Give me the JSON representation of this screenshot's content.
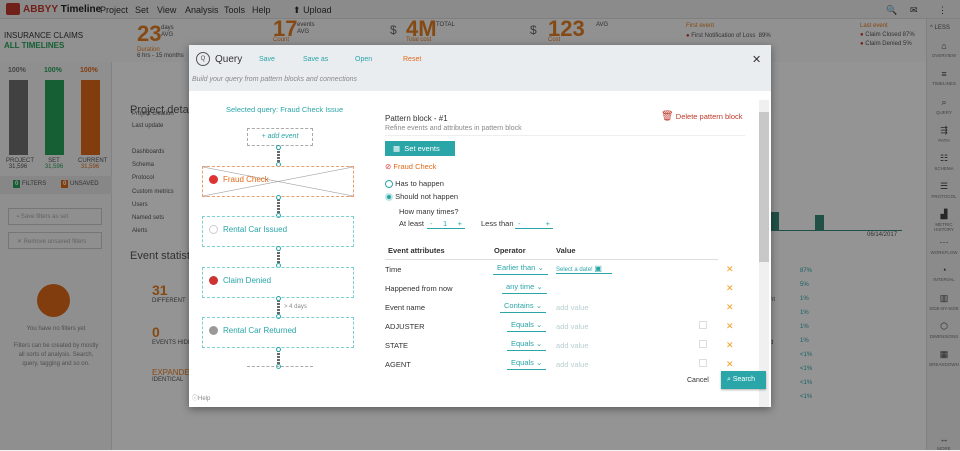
{
  "app": {
    "brand_prefix": "ABBYY",
    "brand_name": "Timeline",
    "menu": [
      "Project",
      "Set",
      "View",
      "Analysis",
      "Tools",
      "Help"
    ],
    "upload": "Upload",
    "icons": [
      "search-icon",
      "mail-icon",
      "more-vert-icon"
    ]
  },
  "stats": {
    "duration": {
      "value": "23",
      "unit1": "days",
      "unit2": "AVG",
      "label": "Duration",
      "range": "6 hrs - 15 months"
    },
    "count": {
      "value": "17",
      "unit1": "events",
      "unit2": "AVG",
      "label": "Count"
    },
    "total_cost": {
      "value": "4M",
      "unit1": "TOTAL",
      "label": "Total cost",
      "currency": "$"
    },
    "cost": {
      "value": "123",
      "unit1": "AVG",
      "label": "Cost",
      "currency": "$"
    },
    "first_event": {
      "title": "First event",
      "items": [
        {
          "name": "First Notification of Loss",
          "pct": "89%"
        }
      ]
    },
    "last_event": {
      "title": "Last event",
      "items": [
        {
          "name": "Claim Closed",
          "pct": "87%"
        },
        {
          "name": "Claim Denied",
          "pct": "5%"
        }
      ]
    },
    "less": "LESS"
  },
  "left": {
    "title": "INSURANCE CLAIMS",
    "subtitle": "ALL TIMELINES",
    "bars": [
      {
        "pct": "100%",
        "label": "PROJECT",
        "count": "31,596",
        "color": "#707070"
      },
      {
        "pct": "100%",
        "label": "SET",
        "count": "31,596",
        "color": "#27a35a"
      },
      {
        "pct": "100%",
        "label": "CURRENT",
        "count": "31,596",
        "color": "#e06a1b"
      }
    ],
    "filters_count": "0",
    "filters_label": "FILTERS",
    "unsaved_count": "0",
    "unsaved_label": "UNSAVED",
    "save_filters": "Save filters as set",
    "remove_filters": "Remove unsaved filters",
    "no_filters": "You have no filters yet",
    "no_filters_desc": "Filters can be created by mostly all sorts of analysis. Search, query, tagging and so on."
  },
  "project": {
    "title": "Project details",
    "items": [
      "Project creation",
      "Last update"
    ],
    "links": [
      "Dashboards",
      "Schema",
      "Protocol",
      "Custom metrics",
      "Users",
      "Named sets",
      "Alerts"
    ],
    "event_stats_title": "Event statistics",
    "stat1_value": "31",
    "stat1_label": "DIFFERENT",
    "stat2_value": "0",
    "stat2_label": "EVENTS HIDDEN",
    "stat3_value": "EXPANDED",
    "stat3_label": "IDENTICAL"
  },
  "chart_bg": {
    "date": "06/14/2017",
    "percents": [
      "87%",
      "5%",
      "1%",
      "1%",
      "1%",
      "1%",
      "<1%",
      "<1%",
      "<1%",
      "<1%"
    ],
    "row_suffixes": [
      "nt",
      "d"
    ]
  },
  "right_nav": [
    {
      "label": "OVERVIEW",
      "icon": "home-icon"
    },
    {
      "label": "TIMELINES",
      "icon": "timelines-icon"
    },
    {
      "label": "QUERY",
      "icon": "query-icon"
    },
    {
      "label": "PATH",
      "icon": "path-icon"
    },
    {
      "label": "SCHEMA",
      "icon": "schema-icon"
    },
    {
      "label": "PROTOCOL",
      "icon": "protocol-icon"
    },
    {
      "label": "METRIC HISTORY",
      "icon": "metric-history-icon"
    },
    {
      "label": "WORKFLOW",
      "icon": "workflow-icon"
    },
    {
      "label": "INTERVAL",
      "icon": "interval-icon"
    },
    {
      "label": "SIDE-BY-SIDE",
      "icon": "side-by-side-icon"
    },
    {
      "label": "DIMENSIONS",
      "icon": "dimensions-icon"
    },
    {
      "label": "BREAKDOWN",
      "icon": "breakdown-icon"
    },
    {
      "label": "MORE",
      "icon": "more-icon"
    }
  ],
  "query": {
    "title": "Query",
    "save": "Save",
    "save_as": "Save as",
    "open": "Open",
    "reset": "Reset",
    "subtitle": "Build your query from pattern blocks and connections",
    "selected_query": "Selected query: Fraud Check Issue",
    "add_event": "+ add event",
    "blocks": [
      {
        "name": "Fraud Check",
        "color": "#e06a1b"
      },
      {
        "name": "Rental Car Issued",
        "color": "#2aa5a8"
      },
      {
        "name": "Claim Denied",
        "color": "#2aa5a8"
      },
      {
        "name": "Rental Car Returned",
        "color": "#2aa5a8"
      }
    ],
    "gap_label": "> 4 days",
    "help": "Help",
    "pattern_title": "Pattern block - #1",
    "pattern_subtitle": "Refine events and attributes in pattern block",
    "delete": "Delete pattern block",
    "set_events": "Set events",
    "selected_event": "Fraud Check",
    "radio_has": "Has to happen",
    "radio_not": "Should not happen",
    "radio_selected": "Should not happen",
    "how_many": "How many times?",
    "at_least": "At least",
    "at_least_value": "1",
    "less_than": "Less than",
    "less_than_value": "",
    "columns": [
      "Event attributes",
      "Operator",
      "Value"
    ],
    "rows": [
      {
        "attr": "Time",
        "op": "Earlier than",
        "value": "Select a date!"
      },
      {
        "attr": "Happened from now",
        "op": "any time",
        "value": ""
      },
      {
        "attr": "Event name",
        "op": "Contains",
        "value": "add value"
      },
      {
        "attr": "ADJUSTER",
        "op": "Equals",
        "value": "add value"
      },
      {
        "attr": "STATE",
        "op": "Equals",
        "value": "add value"
      },
      {
        "attr": "AGENT",
        "op": "Equals",
        "value": "add value"
      }
    ],
    "cancel": "Cancel",
    "search": "Search"
  }
}
